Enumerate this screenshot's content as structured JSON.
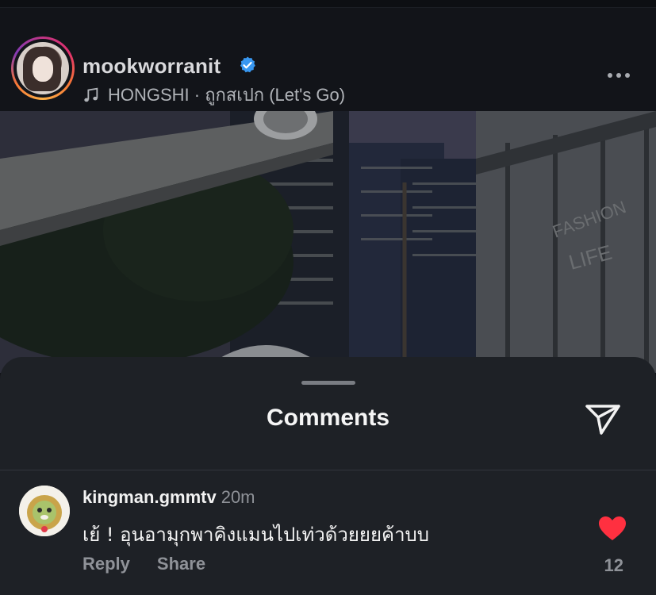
{
  "post": {
    "username": "mookworranit",
    "verified": true,
    "song": "HONGSHI · ถูกสเปก (Let's Go)",
    "icons": {
      "verified": "verified-badge-icon",
      "music": "music-note-icon",
      "more": "more-options-icon"
    }
  },
  "comments_sheet": {
    "title": "Comments",
    "share_icon": "send-icon",
    "comments": [
      {
        "username": "kingman.gmmtv",
        "time": "20m",
        "text": "เย้ ! อุนอามุกพาคิงแมนไปเท่วด้วยยยค้าบบ",
        "reply_label": "Reply",
        "share_label": "Share",
        "likes": "12",
        "liked": true
      }
    ]
  },
  "colors": {
    "background": "#101217",
    "sheet": "#1e2126",
    "verified_blue": "#3897f0",
    "like_red": "#ff3040",
    "muted_text": "#8f9298"
  }
}
